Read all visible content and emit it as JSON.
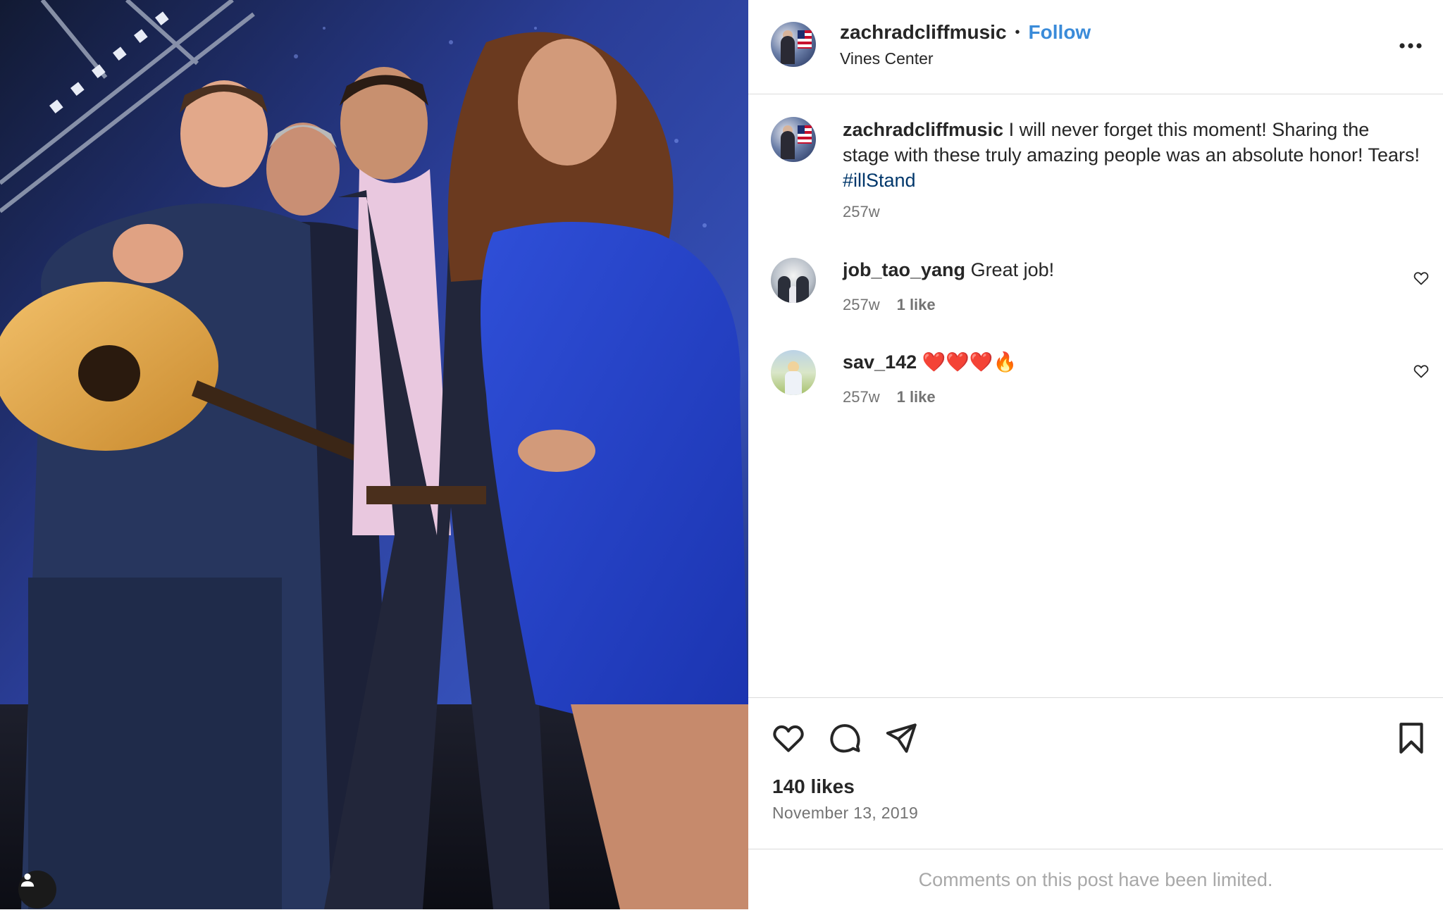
{
  "photo": {
    "description_icon": "person-tag-icon"
  },
  "post_header": {
    "username": "zachradcliffmusic",
    "separator": "•",
    "follow_label": "Follow",
    "location": "Vines Center",
    "more_icon": "ellipsis-icon"
  },
  "caption": {
    "username": "zachradcliffmusic",
    "text": "I will never forget this moment! Sharing the stage with these truly amazing people was an absolute honor! Tears!",
    "hashtag": "#illStand",
    "time": "257w"
  },
  "comments": [
    {
      "username": "job_tao_yang",
      "text": "Great job!",
      "time": "257w",
      "likes": "1 like"
    },
    {
      "username": "sav_142",
      "text": "❤️❤️❤️🔥",
      "time": "257w",
      "likes": "1 like"
    }
  ],
  "stats": {
    "likes": "140 likes",
    "date": "November 13, 2019"
  },
  "footer": {
    "limited_text": "Comments on this post have been limited."
  },
  "colors": {
    "link_blue": "#3a8bd9",
    "hashtag_blue": "#00376b",
    "divider": "#dbdbdb"
  }
}
